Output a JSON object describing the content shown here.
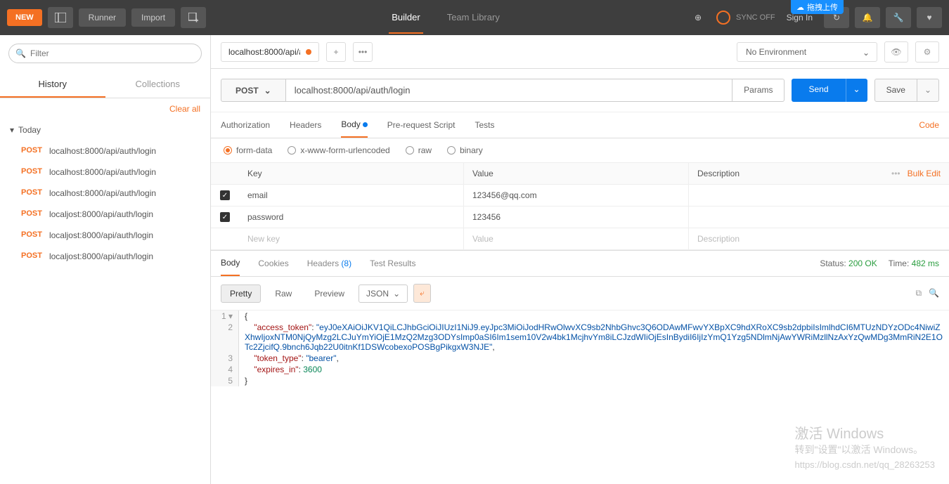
{
  "topbar": {
    "new_label": "NEW",
    "runner_label": "Runner",
    "import_label": "Import",
    "builder_tab": "Builder",
    "team_tab": "Team Library",
    "sync_label": "SYNC OFF",
    "signin_label": "Sign In",
    "float_label": "拖拽上传"
  },
  "sidebar": {
    "filter_placeholder": "Filter",
    "history_tab": "History",
    "collections_tab": "Collections",
    "clear_all": "Clear all",
    "group_label": "Today",
    "items": [
      {
        "method": "POST",
        "url": "localhost:8000/api/auth/login"
      },
      {
        "method": "POST",
        "url": "localhost:8000/api/auth/login"
      },
      {
        "method": "POST",
        "url": "localhost:8000/api/auth/login"
      },
      {
        "method": "POST",
        "url": "localjost:8000/api/auth/login"
      },
      {
        "method": "POST",
        "url": "localjost:8000/api/auth/login"
      },
      {
        "method": "POST",
        "url": "localjost:8000/api/auth/login"
      }
    ]
  },
  "env": {
    "tab_label": "localhost:8000/api/a",
    "no_env": "No Environment"
  },
  "request": {
    "method": "POST",
    "url": "localhost:8000/api/auth/login",
    "params_btn": "Params",
    "send_btn": "Send",
    "save_btn": "Save",
    "tabs": {
      "auth": "Authorization",
      "headers": "Headers",
      "body": "Body",
      "prereq": "Pre-request Script",
      "tests": "Tests"
    },
    "code_link": "Code",
    "body_types": {
      "formdata": "form-data",
      "urlencoded": "x-www-form-urlencoded",
      "raw": "raw",
      "binary": "binary"
    },
    "table": {
      "key_header": "Key",
      "value_header": "Value",
      "desc_header": "Description",
      "bulk_edit": "Bulk Edit",
      "rows": [
        {
          "key": "email",
          "value": "123456@qq.com"
        },
        {
          "key": "password",
          "value": "123456"
        }
      ],
      "new_key": "New key",
      "new_value": "Value",
      "new_desc": "Description"
    }
  },
  "response": {
    "tabs": {
      "body": "Body",
      "cookies": "Cookies",
      "headers": "Headers",
      "headers_count": "(8)",
      "tests": "Test Results"
    },
    "status_label": "Status:",
    "status_value": "200 OK",
    "time_label": "Time:",
    "time_value": "482 ms",
    "view": {
      "pretty": "Pretty",
      "raw": "Raw",
      "preview": "Preview",
      "format": "JSON"
    },
    "json": {
      "access_token_key": "\"access_token\"",
      "access_token_val": "\"eyJ0eXAiOiJKV1QiLCJhbGciOiJIUzI1NiJ9.eyJpc3MiOiJodHRwOlwvXC9sb2NhbGhvc3Q6ODAwMFwvYXBpXC9hdXRoXC9sb2dpbiIsImlhdCI6MTUzNDYzODc4NiwiZXhwIjoxNTM0NjQyMzg2LCJuYmYiOjE1MzQ2Mzg3ODYsImp0aSI6Im1sem10V2w4bk1McjhvYm8iLCJzdWIiOjEsInBydiI6IjIzYmQ1Yzg5NDlmNjAwYWRiMzllNzAxYzQwMDg3MmRiN2E1OTc2ZjcifQ.9bnch6Jqb22U0itnKf1DSWcobexoPOSBgPikgxW3NJE\"",
      "token_type_key": "\"token_type\"",
      "token_type_val": "\"bearer\"",
      "expires_key": "\"expires_in\"",
      "expires_val": "3600"
    }
  },
  "watermark": {
    "line1": "激活 Windows",
    "line2": "转到\"设置\"以激活 Windows。",
    "url": "https://blog.csdn.net/qq_28263253"
  }
}
